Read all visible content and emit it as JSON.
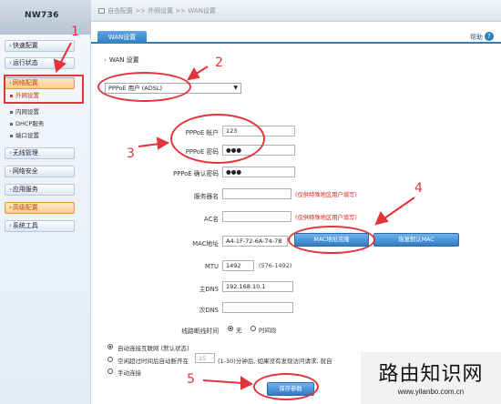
{
  "sidebar": {
    "brand": "NW736",
    "items": [
      {
        "label": "快速配置"
      },
      {
        "label": "运行状态"
      },
      {
        "label": "网络配置"
      },
      {
        "label": "无线管理"
      },
      {
        "label": "网络安全"
      },
      {
        "label": "应用服务"
      },
      {
        "label": "高级配置"
      },
      {
        "label": "系统工具"
      }
    ],
    "subitems": [
      {
        "label": "外网设置"
      },
      {
        "label": "内网设置"
      },
      {
        "label": "DHCP服务"
      },
      {
        "label": "端口设置"
      }
    ]
  },
  "breadcrumb": "自由配置  >>  外网设置  >>  WAN设置",
  "tab": {
    "label": "WAN设置"
  },
  "help": {
    "label": "帮助"
  },
  "section_title": "WAN 设置",
  "wan_type": {
    "value": "PPPoE 用户 (ADSL)"
  },
  "form": {
    "pppoe_account": {
      "label": "PPPoE 帐户",
      "value": "123"
    },
    "pppoe_password": {
      "label": "PPPoE 密码",
      "value": "●●●"
    },
    "pppoe_confirm": {
      "label": "PPPoE 确认密码",
      "value": "●●●"
    },
    "service_name": {
      "label": "服务器名",
      "value": "",
      "hint": "(仅供特殊地区用户填写)"
    },
    "ac_name": {
      "label": "AC名",
      "value": "",
      "hint": "(仅供特殊地区用户填写)"
    },
    "mac": {
      "label": "MAC地址",
      "value": "A4-1F-72-6A-74-7B",
      "clone_button": "MAC地址克隆",
      "default_button": "恢复默认MAC"
    },
    "mtu": {
      "label": "MTU",
      "value": "1492",
      "hint": "(576-1492)"
    },
    "primary_dns": {
      "label": "主DNS",
      "value": "192.168.10.1"
    },
    "secondary_dns": {
      "label": "次DNS",
      "value": ""
    },
    "online_time": {
      "label": "线路断线时间",
      "options": [
        "无",
        "时间段"
      ],
      "selected": "无"
    }
  },
  "connect_modes": {
    "auto": "自动连接互联网 (默认状态)",
    "idle_prefix": "空闲超过时间后自动断开在",
    "idle_value": "15",
    "idle_suffix": "(1-30)分钟后, 如果没有发现访问请求, 就自",
    "manual": "手动连接"
  },
  "save_button": "保存参数",
  "annotations": {
    "n1": "1",
    "n2": "2",
    "n3": "3",
    "n4": "4",
    "n5": "5"
  },
  "watermark": {
    "main": "路由知识网",
    "url": "www.yilanbo.com.cn"
  },
  "colors": {
    "accent": "#2c7fbf",
    "annotation": "#e2343a",
    "hint": "#d42a1e"
  }
}
